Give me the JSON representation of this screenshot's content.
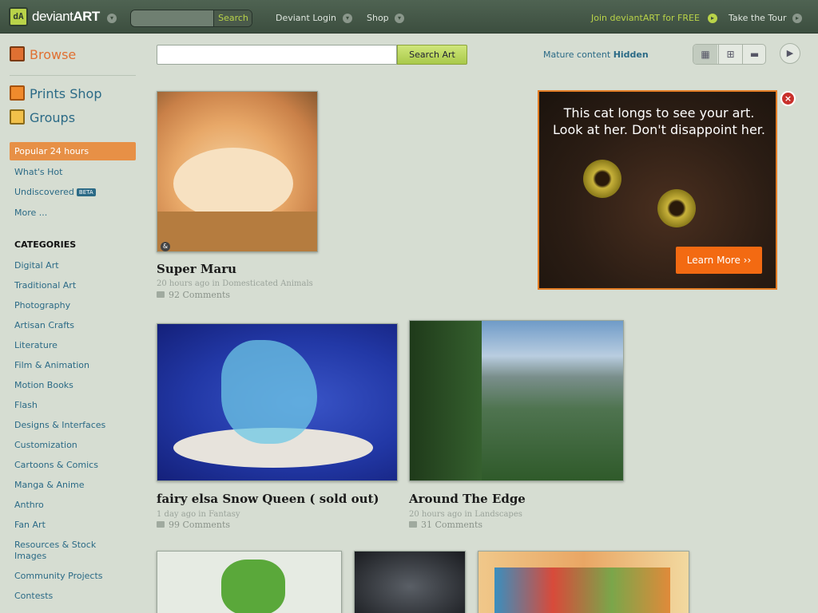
{
  "header": {
    "logo_text": "deviant",
    "logo_bold": "ART",
    "search_placeholder": "",
    "search_button": "Search",
    "deviant_login": "Deviant Login",
    "shop": "Shop",
    "join": "Join deviantART for FREE",
    "tour": "Take the Tour"
  },
  "sidebar": {
    "browse": "Browse",
    "prints_shop": "Prints Shop",
    "groups": "Groups",
    "popular": "Popular 24 hours",
    "whats_hot": "What's Hot",
    "undiscovered": "Undiscovered",
    "beta": "BETA",
    "more": "More ...",
    "categories_heading": "CATEGORIES",
    "categories": [
      "Digital Art",
      "Traditional Art",
      "Photography",
      "Artisan Crafts",
      "Literature",
      "Film & Animation",
      "Motion Books",
      "Flash",
      "Designs & Interfaces",
      "Customization",
      "Cartoons & Comics",
      "Manga & Anime",
      "Anthro",
      "Fan Art",
      "Resources & Stock",
      "Images",
      "Community Projects",
      "Contests"
    ]
  },
  "main": {
    "search_value": "",
    "search_button": "Search Art",
    "mature_label": "Mature content",
    "mature_value": "Hidden",
    "items": [
      {
        "title": "Super Maru",
        "meta_time": "20 hours ago in",
        "meta_cat": "Domesticated Animals",
        "comments": "92 Comments"
      },
      {
        "title": "fairy elsa Snow Queen ( sold out)",
        "meta_time": "1 day ago in",
        "meta_cat": "Fantasy",
        "comments": "99 Comments"
      },
      {
        "title": "Around The Edge",
        "meta_time": "20 hours ago in",
        "meta_cat": "Landscapes",
        "comments": "31 Comments"
      }
    ]
  },
  "ad": {
    "line1": "This cat longs to see your art.",
    "line2": "Look at her. Don't disappoint her.",
    "button": "Learn More ››"
  },
  "colors": {
    "accent_orange": "#e07032",
    "link_blue": "#2b6a86",
    "brand_green": "#b9d349",
    "header_bg": "#455848",
    "page_bg": "#d6ddd2"
  }
}
